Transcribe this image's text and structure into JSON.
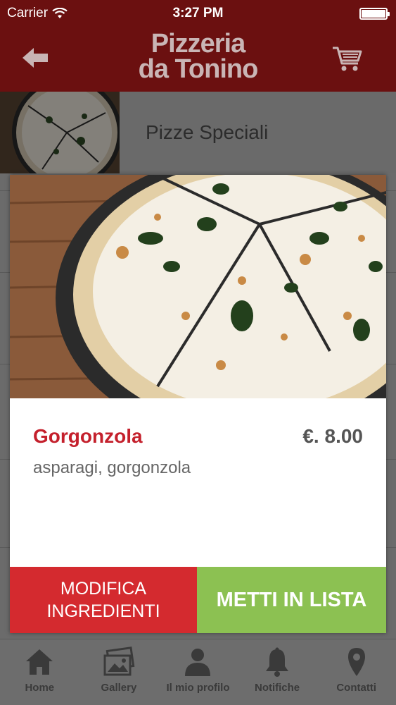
{
  "status_bar": {
    "carrier": "Carrier",
    "time": "3:27 PM"
  },
  "header": {
    "logo_line1": "Pizzeria",
    "logo_line2": "da Tonino",
    "back_icon": "back-arrow-icon",
    "cart_icon": "cart-icon"
  },
  "category": {
    "label": "Pizze Speciali"
  },
  "product": {
    "name": "Gorgonzola",
    "price": "€. 8.00",
    "ingredients": "asparagi, gorgonzola",
    "modify_line1": "MODIFICA",
    "modify_line2": "INGREDIENTI",
    "add_label": "METTI IN LISTA"
  },
  "tabbar": {
    "items": [
      {
        "label": "Home",
        "icon": "home-icon"
      },
      {
        "label": "Gallery",
        "icon": "gallery-icon"
      },
      {
        "label": "Il mio profilo",
        "icon": "profile-icon"
      },
      {
        "label": "Notifiche",
        "icon": "bell-icon"
      },
      {
        "label": "Contatti",
        "icon": "location-pin-icon"
      }
    ]
  },
  "colors": {
    "header": "#6b1010",
    "product_name": "#c4202c",
    "modify_button": "#d42a2f",
    "add_button": "#8cc152"
  }
}
